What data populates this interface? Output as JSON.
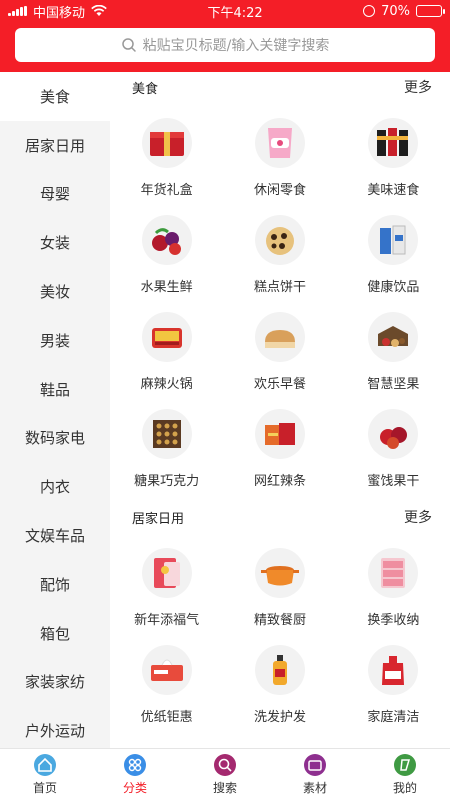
{
  "status_bar": {
    "carrier": "中国移动",
    "time": "下午4:22",
    "battery": "70%",
    "battery_level": 0.7
  },
  "search": {
    "placeholder": "粘贴宝贝标题/输入关键字搜索"
  },
  "sidebar": {
    "items": [
      {
        "label": "美食",
        "active": true
      },
      {
        "label": "居家日用"
      },
      {
        "label": "母婴"
      },
      {
        "label": "女装"
      },
      {
        "label": "美妆"
      },
      {
        "label": "男装"
      },
      {
        "label": "鞋品"
      },
      {
        "label": "数码家电"
      },
      {
        "label": "内衣"
      },
      {
        "label": "文娱车品"
      },
      {
        "label": "配饰"
      },
      {
        "label": "箱包"
      },
      {
        "label": "家装家纺"
      },
      {
        "label": "户外运动"
      }
    ]
  },
  "sections": [
    {
      "title": "美食",
      "more": "更多",
      "items": [
        {
          "label": "年货礼盒",
          "icon": "gift-box-icon"
        },
        {
          "label": "休闲零食",
          "icon": "snack-bag-icon"
        },
        {
          "label": "美味速食",
          "icon": "instant-noodle-icon"
        },
        {
          "label": "水果生鲜",
          "icon": "fruit-icon"
        },
        {
          "label": "糕点饼干",
          "icon": "cookie-icon"
        },
        {
          "label": "健康饮品",
          "icon": "drink-icon"
        },
        {
          "label": "麻辣火锅",
          "icon": "hotpot-icon"
        },
        {
          "label": "欢乐早餐",
          "icon": "bread-icon"
        },
        {
          "label": "智慧坚果",
          "icon": "nuts-icon"
        },
        {
          "label": "糖果巧克力",
          "icon": "chocolate-icon"
        },
        {
          "label": "网红辣条",
          "icon": "spicy-strip-icon"
        },
        {
          "label": "蜜饯果干",
          "icon": "dried-fruit-icon"
        }
      ]
    },
    {
      "title": "居家日用",
      "more": "更多",
      "items": [
        {
          "label": "新年添福气",
          "icon": "red-envelope-icon"
        },
        {
          "label": "精致餐厨",
          "icon": "pot-icon"
        },
        {
          "label": "换季收纳",
          "icon": "storage-drawer-icon"
        },
        {
          "label": "优纸钜惠",
          "icon": "tissue-icon"
        },
        {
          "label": "洗发护发",
          "icon": "shampoo-icon"
        },
        {
          "label": "家庭清洁",
          "icon": "detergent-icon"
        }
      ]
    }
  ],
  "tabbar": {
    "items": [
      {
        "label": "首页",
        "icon": "home-icon"
      },
      {
        "label": "分类",
        "icon": "category-icon",
        "active": true
      },
      {
        "label": "搜索",
        "icon": "search-icon"
      },
      {
        "label": "素材",
        "icon": "material-icon"
      },
      {
        "label": "我的",
        "icon": "profile-icon"
      }
    ]
  },
  "colors": {
    "accent": "#f41e27",
    "sidebar_bg": "#f4f4f4"
  }
}
